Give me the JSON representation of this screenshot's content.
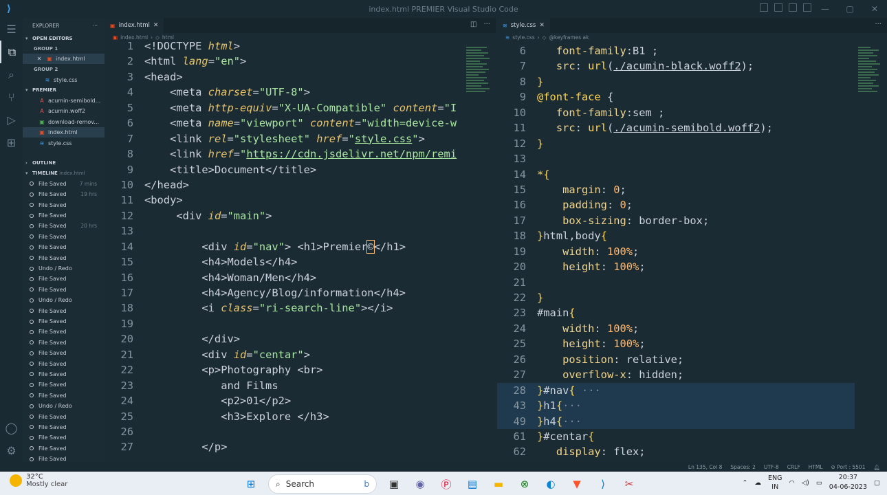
{
  "titlebar": {
    "title": "index.html  PREMIER  Visual Studio Code"
  },
  "sidebar": {
    "header": "EXPLORER",
    "open_editors": "OPEN EDITORS",
    "group1": "GROUP 1",
    "group1_file": "index.html",
    "group2": "GROUP 2",
    "group2_file": "style.css",
    "project": "PREMIER",
    "files": [
      "acumin-semibold...",
      "acumin.woff2",
      "download-remov...",
      "index.html",
      "style.css"
    ],
    "outline": "OUTLINE",
    "timeline": "TIMELINE",
    "timeline_file": "index.html",
    "timeline_items": [
      {
        "label": "File Saved",
        "ago": "7 mins"
      },
      {
        "label": "File Saved",
        "ago": "19 hrs"
      },
      {
        "label": "File Saved",
        "ago": ""
      },
      {
        "label": "File Saved",
        "ago": ""
      },
      {
        "label": "File Saved",
        "ago": "20 hrs"
      },
      {
        "label": "File Saved",
        "ago": ""
      },
      {
        "label": "File Saved",
        "ago": ""
      },
      {
        "label": "File Saved",
        "ago": ""
      },
      {
        "label": "Undo / Redo",
        "ago": ""
      },
      {
        "label": "File Saved",
        "ago": ""
      },
      {
        "label": "File Saved",
        "ago": ""
      },
      {
        "label": "Undo / Redo",
        "ago": ""
      },
      {
        "label": "File Saved",
        "ago": ""
      },
      {
        "label": "File Saved",
        "ago": ""
      },
      {
        "label": "File Saved",
        "ago": ""
      },
      {
        "label": "File Saved",
        "ago": ""
      },
      {
        "label": "File Saved",
        "ago": ""
      },
      {
        "label": "File Saved",
        "ago": ""
      },
      {
        "label": "File Saved",
        "ago": ""
      },
      {
        "label": "File Saved",
        "ago": ""
      },
      {
        "label": "File Saved",
        "ago": ""
      },
      {
        "label": "Undo / Redo",
        "ago": ""
      },
      {
        "label": "File Saved",
        "ago": ""
      },
      {
        "label": "File Saved",
        "ago": ""
      },
      {
        "label": "File Saved",
        "ago": ""
      },
      {
        "label": "File Saved",
        "ago": ""
      },
      {
        "label": "File Saved",
        "ago": ""
      }
    ]
  },
  "editor1": {
    "tab": "index.html",
    "crumb_file": "index.html",
    "crumb_node": "html",
    "lines": [
      {
        "n": "1",
        "html": "&lt;!DOCTYPE <span class='at'>html</span>&gt;"
      },
      {
        "n": "2",
        "html": "&lt;html <span class='at'>lang</span>=<span class='st'>\"en\"</span>&gt;"
      },
      {
        "n": "3",
        "html": "&lt;head&gt;"
      },
      {
        "n": "4",
        "html": "    &lt;meta <span class='at'>charset</span>=<span class='st'>\"UTF-8\"</span>&gt;"
      },
      {
        "n": "5",
        "html": "    &lt;meta <span class='at'>http-equiv</span>=<span class='st'>\"X-UA-Compatible\"</span> <span class='at'>content</span>=<span class='st'>\"I</span>"
      },
      {
        "n": "6",
        "html": "    &lt;meta <span class='at'>name</span>=<span class='st'>\"viewport\"</span> <span class='at'>content</span>=<span class='st'>\"width=device-w</span>"
      },
      {
        "n": "7",
        "html": "    &lt;link <span class='at'>rel</span>=<span class='st'>\"stylesheet\"</span> <span class='at'>href</span>=<span class='st'>\"<span class='ul'>style.css</span>\"</span>&gt;"
      },
      {
        "n": "8",
        "html": "    &lt;link <span class='at'>href</span>=<span class='st'>\"<span class='ul'>https://cdn.jsdelivr.net/npm/remi</span></span>"
      },
      {
        "n": "9",
        "html": "    &lt;title&gt;Document&lt;/title&gt;"
      },
      {
        "n": "10",
        "html": "&lt;/head&gt;"
      },
      {
        "n": "11",
        "html": "&lt;body&gt;"
      },
      {
        "n": "12",
        "html": "     &lt;div <span class='at'>id</span>=<span class='st'>\"main\"</span>&gt;"
      },
      {
        "n": "13",
        "html": ""
      },
      {
        "n": "14",
        "html": "         &lt;div <span class='at'>id</span>=<span class='st'>\"nav\"</span>&gt; &lt;h1&gt;Premier<span style='outline:1px solid #ffb86c'>©</span>&lt;/h1&gt;"
      },
      {
        "n": "15",
        "html": "         &lt;h4&gt;Models&lt;/h4&gt;"
      },
      {
        "n": "16",
        "html": "         &lt;h4&gt;Woman/Men&lt;/h4&gt;"
      },
      {
        "n": "17",
        "html": "         &lt;h4&gt;Agency/Blog/information&lt;/h4&gt;"
      },
      {
        "n": "18",
        "html": "         &lt;i <span class='at'>class</span>=<span class='st'>\"ri-search-line\"</span>&gt;&lt;/i&gt;"
      },
      {
        "n": "19",
        "html": ""
      },
      {
        "n": "20",
        "html": "         &lt;/div&gt;"
      },
      {
        "n": "21",
        "html": "         &lt;div <span class='at'>id</span>=<span class='st'>\"centar\"</span>&gt;"
      },
      {
        "n": "22",
        "html": "         &lt;p&gt;Photography &lt;br&gt;"
      },
      {
        "n": "23",
        "html": "            and Films"
      },
      {
        "n": "24",
        "html": "            &lt;p2&gt;01&lt;/p2&gt;"
      },
      {
        "n": "25",
        "html": "            &lt;h3&gt;Explore &lt;/h3&gt;"
      },
      {
        "n": "26",
        "html": ""
      },
      {
        "n": "27",
        "html": "         &lt;/p&gt;"
      }
    ]
  },
  "editor2": {
    "tab": "style.css",
    "crumb_file": "style.css",
    "crumb_node": "@keyframes ak",
    "lines": [
      {
        "n": "6",
        "html": "   <span class='pr'>font-family</span>:B1 ;",
        "hl": false
      },
      {
        "n": "7",
        "html": "   <span class='pr'>src</span>: <span class='fn'>url</span>(<span class='ul'>./acumin-black.woff2</span>);",
        "hl": false
      },
      {
        "n": "8",
        "html": "<span class='sel2'>}</span>",
        "hl": false
      },
      {
        "n": "9",
        "html": "<span class='sel2'>@font-face</span> {",
        "hl": false
      },
      {
        "n": "10",
        "html": "   <span class='pr'>font-family</span>:sem ;",
        "hl": false
      },
      {
        "n": "11",
        "html": "   <span class='pr'>src</span>: <span class='fn'>url</span>(<span class='ul'>./acumin-semibold.woff2</span>);",
        "hl": false
      },
      {
        "n": "12",
        "html": "<span class='sel2'>}</span>",
        "hl": false
      },
      {
        "n": "13",
        "html": "",
        "hl": false
      },
      {
        "n": "14",
        "html": "<span class='sel2'>*{</span>",
        "hl": false
      },
      {
        "n": "15",
        "html": "    <span class='pr'>margin</span>: <span class='nm'>0</span>;",
        "hl": false
      },
      {
        "n": "16",
        "html": "    <span class='pr'>padding</span>: <span class='nm'>0</span>;",
        "hl": false
      },
      {
        "n": "17",
        "html": "    <span class='pr'>box-sizing</span>: border-box;",
        "hl": false
      },
      {
        "n": "18",
        "html": "<span class='sel2'>}</span>html,body<span class='sel2'>{</span>",
        "hl": false
      },
      {
        "n": "19",
        "html": "    <span class='pr'>width</span>: <span class='nm'>100%</span>;",
        "hl": false
      },
      {
        "n": "20",
        "html": "    <span class='pr'>height</span>: <span class='nm'>100%</span>;",
        "hl": false
      },
      {
        "n": "21",
        "html": "",
        "hl": false
      },
      {
        "n": "22",
        "html": "<span class='sel2'>}</span>",
        "hl": false
      },
      {
        "n": "23",
        "html": "#main<span class='sel2'>{</span>",
        "hl": false
      },
      {
        "n": "24",
        "html": "    <span class='pr'>width</span>: <span class='nm'>100%</span>;",
        "hl": false
      },
      {
        "n": "25",
        "html": "    <span class='pr'>height</span>: <span class='nm'>100%</span>;",
        "hl": false
      },
      {
        "n": "26",
        "html": "    <span class='pr'>position</span>: relative;",
        "hl": false
      },
      {
        "n": "27",
        "html": "    <span class='pr'>overflow-x</span>: hidden;",
        "hl": false
      },
      {
        "n": "28",
        "html": "<span class='sel2'>}</span>#nav<span class='sel2'>{</span> <span style='color:#7b8b96'>···</span>",
        "hl": true
      },
      {
        "n": "43",
        "html": "<span class='sel2'>}</span>h1<span class='sel2'>{</span><span style='color:#7b8b96'>···</span>",
        "hl": true
      },
      {
        "n": "49",
        "html": "<span class='sel2'>}</span>h4<span class='sel2'>{</span><span style='color:#7b8b96'>···</span>",
        "hl": true
      },
      {
        "n": "61",
        "html": "<span class='sel2'>}</span>#centar<span class='sel2'>{</span>",
        "hl": false
      },
      {
        "n": "62",
        "html": "   <span class='pr'>display</span>: flex;",
        "hl": false
      }
    ]
  },
  "status": {
    "position": "Ln 135, Col 8",
    "spaces": "Spaces: 2",
    "encoding": "UTF-8",
    "eol": "CRLF",
    "language": "HTML",
    "port": "Port : 5501"
  },
  "taskbar": {
    "temp": "32°C",
    "weather": "Mostly clear",
    "search": "Search",
    "lang1": "ENG",
    "lang2": "IN",
    "time": "20:37",
    "date": "04-06-2023"
  }
}
